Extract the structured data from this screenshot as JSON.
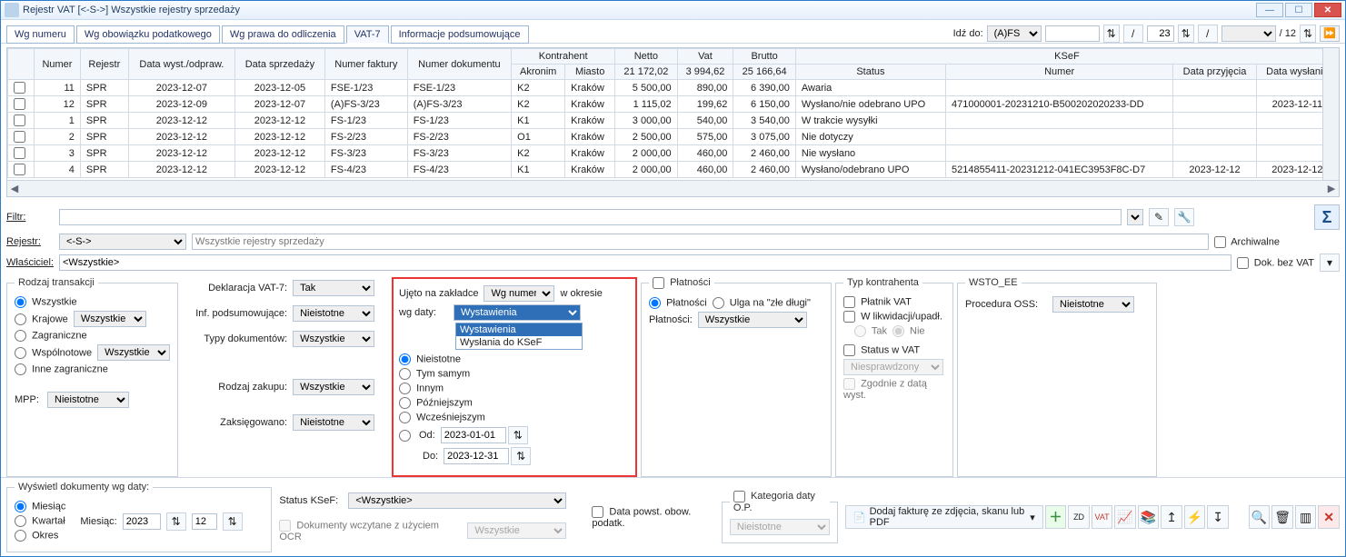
{
  "window": {
    "title": "Rejestr VAT  [<-S->]   Wszystkie rejestry sprzedaży"
  },
  "tabs": {
    "t0": "Wg numeru",
    "t1": "Wg obowiązku podatkowego",
    "t2": "Wg prawa do odliczenia",
    "t3": "VAT-7",
    "t4": "Informacje podsumowujące"
  },
  "goto": {
    "label": "Idź do:",
    "dropdown1": "(A)FS",
    "page_current": "23",
    "page_total": "/ 12"
  },
  "grid": {
    "headers": {
      "numer": "Numer",
      "rejestr": "Rejestr",
      "data_wyst": "Data wyst./odpraw.",
      "data_sprz": "Data sprzedaży",
      "numer_faktury": "Numer faktury",
      "numer_dok": "Numer dokumentu",
      "kontrahent": "Kontrahent",
      "akronim": "Akronim",
      "miasto": "Miasto",
      "netto": "Netto",
      "vat": "Vat",
      "brutto": "Brutto",
      "ksef": "KSeF",
      "status": "Status",
      "ksef_numer": "Numer",
      "data_przyj": "Data przyjęcia",
      "data_wysl": "Data wysłania"
    },
    "totals": {
      "netto": "21 172,02",
      "vat": "3 994,62",
      "brutto": "25 166,64"
    },
    "rows": [
      {
        "lp": "11",
        "rej": "SPR",
        "dw": "2023-12-07",
        "ds": "2023-12-05",
        "nf": "FSE-1/23",
        "nd": "FSE-1/23",
        "akr": "K2",
        "mia": "Kraków",
        "net": "5 500,00",
        "vat": "890,00",
        "bru": "6 390,00",
        "st": "Awaria",
        "kn": "",
        "dp": "",
        "dwys": ""
      },
      {
        "lp": "12",
        "rej": "SPR",
        "dw": "2023-12-09",
        "ds": "2023-12-07",
        "nf": "(A)FS-3/23",
        "nd": "(A)FS-3/23",
        "akr": "K2",
        "mia": "Kraków",
        "net": "1 115,02",
        "vat": "199,62",
        "bru": "6 150,00",
        "st": "Wysłano/nie odebrano UPO",
        "kn": "471000001-20231210-B500202020233-DD",
        "dp": "",
        "dwys": "2023-12-11"
      },
      {
        "lp": "1",
        "rej": "SPR",
        "dw": "2023-12-12",
        "ds": "2023-12-12",
        "nf": "FS-1/23",
        "nd": "FS-1/23",
        "akr": "K1",
        "mia": "Kraków",
        "net": "3 000,00",
        "vat": "540,00",
        "bru": "3 540,00",
        "st": "W trakcie wysyłki",
        "kn": "",
        "dp": "",
        "dwys": ""
      },
      {
        "lp": "2",
        "rej": "SPR",
        "dw": "2023-12-12",
        "ds": "2023-12-12",
        "nf": "FS-2/23",
        "nd": "FS-2/23",
        "akr": "O1",
        "mia": "Kraków",
        "net": "2 500,00",
        "vat": "575,00",
        "bru": "3 075,00",
        "st": "Nie dotyczy",
        "kn": "",
        "dp": "",
        "dwys": ""
      },
      {
        "lp": "3",
        "rej": "SPR",
        "dw": "2023-12-12",
        "ds": "2023-12-12",
        "nf": "FS-3/23",
        "nd": "FS-3/23",
        "akr": "K2",
        "mia": "Kraków",
        "net": "2 000,00",
        "vat": "460,00",
        "bru": "2 460,00",
        "st": "Nie wysłano",
        "kn": "",
        "dp": "",
        "dwys": ""
      },
      {
        "lp": "4",
        "rej": "SPR",
        "dw": "2023-12-12",
        "ds": "2023-12-12",
        "nf": "FS-4/23",
        "nd": "FS-4/23",
        "akr": "K1",
        "mia": "Kraków",
        "net": "2 000,00",
        "vat": "460,00",
        "bru": "2 460,00",
        "st": "Wysłano/odebrano UPO",
        "kn": "5214855411-20231212-041EC3953F8C-D7",
        "dp": "2023-12-12",
        "dwys": "2023-12-12"
      }
    ]
  },
  "filter": {
    "filtr_label": "Filtr:",
    "rejestr_label": "Rejestr:",
    "rejestr_val": "<-S->",
    "rejestr_desc": "Wszystkie rejestry sprzedaży",
    "wlasciciel_label": "Właściciel:",
    "wlasciciel_val": "<Wszystkie>",
    "archiwalne": "Archiwalne",
    "dokbezvat": "Dok. bez VAT"
  },
  "rodzaj": {
    "legend": "Rodzaj transakcji",
    "r0": "Wszystkie",
    "r1": "Krajowe",
    "r2": "Zagraniczne",
    "r3": "Wspólnotowe",
    "r4": "Inne zagraniczne",
    "sel": "Wszystkie",
    "mpp_label": "MPP:",
    "mpp_val": "Nieistotne"
  },
  "dekl": {
    "vat7": "Deklaracja VAT-7:",
    "vat7_v": "Tak",
    "inf": "Inf. podsumowujące:",
    "inf_v": "Nieistotne",
    "typy": "Typy dokumentów:",
    "typy_v": "Wszystkie",
    "rz": "Rodzaj zakupu:",
    "rz_v": "Wszystkie",
    "zaks": "Zaksięgowano:",
    "zaks_v": "Nieistotne"
  },
  "ujeto": {
    "legend": "Ujęto na zakładce",
    "sel": "Wg numeru",
    "okres": "w okresie",
    "wgdaty": "wg daty:",
    "dd_val": "Wystawienia",
    "opt1": "Wystawienia",
    "opt2": "Wysłania do KSeF",
    "r_nieist": "Nieistotne",
    "r_tym": "Tym samym",
    "r_innym": "Innym",
    "r_pozn": "Późniejszym",
    "r_wcz": "Wcześniejszym",
    "od": "Od:",
    "od_v": "2023-01-01",
    "do": "Do:",
    "do_v": "2023-12-31"
  },
  "platnosci": {
    "legend": "Płatności",
    "r1": "Płatności",
    "r2": "Ulga na \"złe długi\"",
    "lbl": "Płatności:",
    "val": "Wszystkie"
  },
  "typk": {
    "legend": "Typ kontrahenta",
    "platvat": "Płatnik VAT",
    "likw": "W likwidacji/upadł.",
    "tak": "Tak",
    "nie": "Nie",
    "status": "Status w VAT",
    "status_v": "Niesprawdzony",
    "zgodnie": "Zgodnie z datą wyst."
  },
  "wsto": {
    "legend": "WSTO_EE",
    "proc": "Procedura OSS:",
    "proc_v": "Nieistotne"
  },
  "wys": {
    "legend": "Wyświetl dokumenty wg daty:",
    "r1": "Miesiąc",
    "r2": "Kwartał",
    "r3": "Okres",
    "miesiac_lbl": "Miesiąc:",
    "rok": "2023",
    "mies": "12"
  },
  "statusksef": {
    "label": "Status KSeF:",
    "val": "<Wszystkie>",
    "ocr": "Dokumenty wczytane z użyciem OCR",
    "ocr_v": "Wszystkie",
    "data_obow": "Data powst. obow. podatk.",
    "kat": "Kategoria daty O.P.",
    "kat_v": "Nieistotne",
    "dodaj": "Dodaj fakturę ze zdjęcia, skanu lub PDF"
  }
}
